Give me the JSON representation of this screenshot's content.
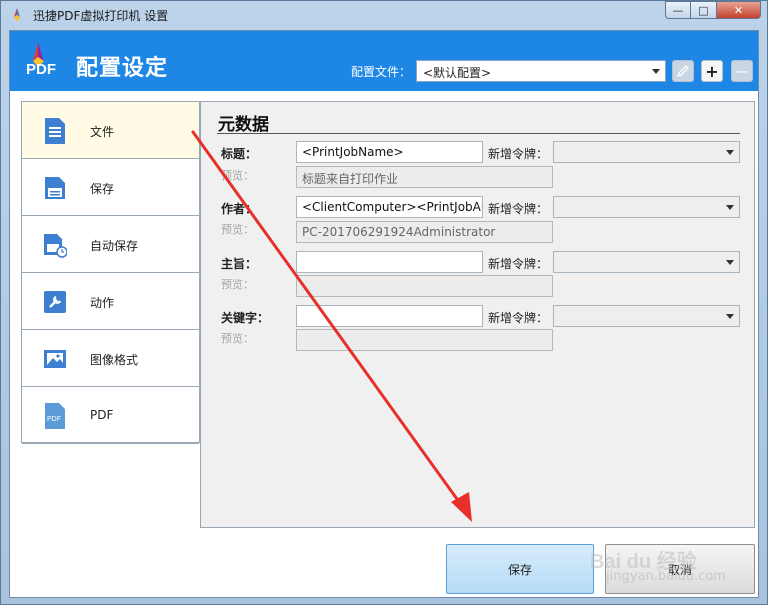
{
  "window": {
    "title": "迅捷PDF虚拟打印机 设置",
    "minimize_glyph": "—",
    "maximize_glyph": "□",
    "close_glyph": "✕"
  },
  "header": {
    "logo_text": "PDF",
    "title": "配置设定",
    "profile_label": "配置文件：",
    "profile_value": "<默认配置>",
    "add_glyph": "+",
    "remove_glyph": "−"
  },
  "sidebar": {
    "items": [
      {
        "label": "文件",
        "icon": "document-icon"
      },
      {
        "label": "保存",
        "icon": "save-icon"
      },
      {
        "label": "自动保存",
        "icon": "autosave-icon"
      },
      {
        "label": "动作",
        "icon": "wrench-icon"
      },
      {
        "label": "图像格式",
        "icon": "image-icon"
      },
      {
        "label": "PDF",
        "icon": "pdf-icon"
      }
    ],
    "active_index": 0
  },
  "panel": {
    "title": "元数据",
    "preview_label": "预览：",
    "token_label": "新增令牌：",
    "fields": [
      {
        "label": "标题：",
        "value": "<PrintJobName>",
        "preview": "标题来自打印作业"
      },
      {
        "label": "作者：",
        "value": "<ClientComputer><PrintJobAu",
        "preview": "PC-201706291924Administrator"
      },
      {
        "label": "主旨：",
        "value": "",
        "preview": ""
      },
      {
        "label": "关键字：",
        "value": "",
        "preview": ""
      }
    ]
  },
  "buttons": {
    "save": "保存",
    "cancel": "取消"
  },
  "watermark": {
    "text": "Bai du 经验",
    "sub": "jingyan.baidu.com"
  },
  "colors": {
    "header_blue": "#1e87e5",
    "active_item": "#fffbe5",
    "annotation_red": "#e8302a"
  }
}
